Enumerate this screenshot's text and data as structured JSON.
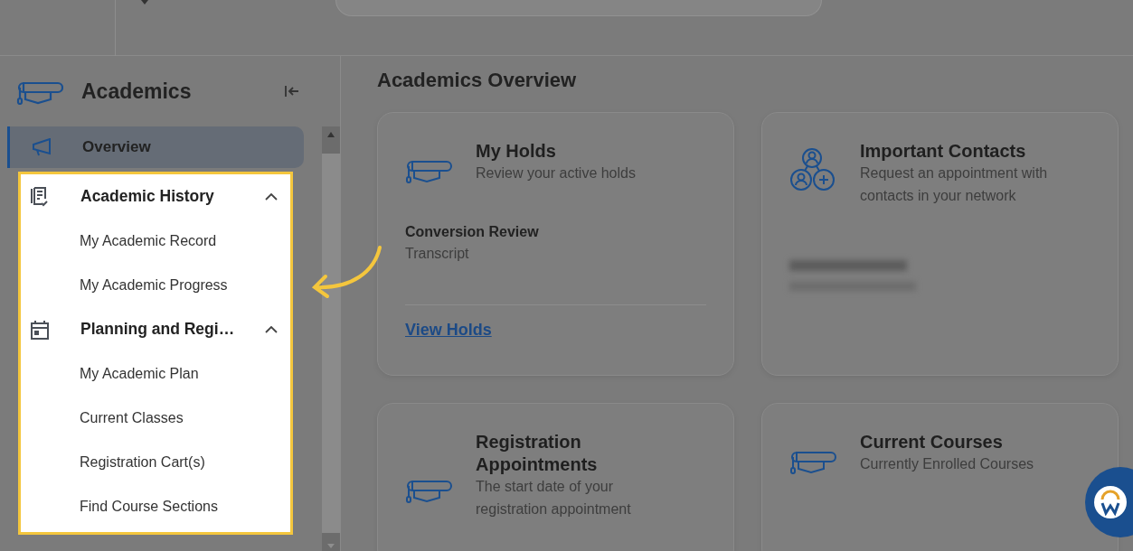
{
  "sidebar": {
    "title": "Academics",
    "items": [
      {
        "label": "Overview",
        "kind": "link",
        "selected": true,
        "highlighted": false
      },
      {
        "label": "Academic History",
        "kind": "group",
        "selected": false,
        "highlighted": true,
        "expanded": true,
        "children": [
          {
            "label": "My Academic Record"
          },
          {
            "label": "My Academic Progress"
          }
        ]
      },
      {
        "label": "Planning and Regi…",
        "kind": "group",
        "selected": false,
        "highlighted": true,
        "expanded": true,
        "children": [
          {
            "label": "My Academic Plan"
          },
          {
            "label": "Current Classes"
          },
          {
            "label": "Registration Cart(s)"
          },
          {
            "label": "Find Course Sections"
          }
        ]
      }
    ]
  },
  "main": {
    "title": "Academics Overview",
    "cards": [
      {
        "kind": "holds",
        "title": "My Holds",
        "subtitle": "Review your active holds",
        "hold_title": "Conversion Review",
        "hold_detail": "Transcript",
        "link": "View Holds"
      },
      {
        "kind": "contacts",
        "title": "Important Contacts",
        "subtitle": "Request an appointment with contacts in your network"
      },
      {
        "kind": "simple",
        "title": "Registration Appointments",
        "subtitle": "The start date of your registration appointment"
      },
      {
        "kind": "simple",
        "title": "Current Courses",
        "subtitle": "Currently Enrolled Courses"
      }
    ]
  }
}
